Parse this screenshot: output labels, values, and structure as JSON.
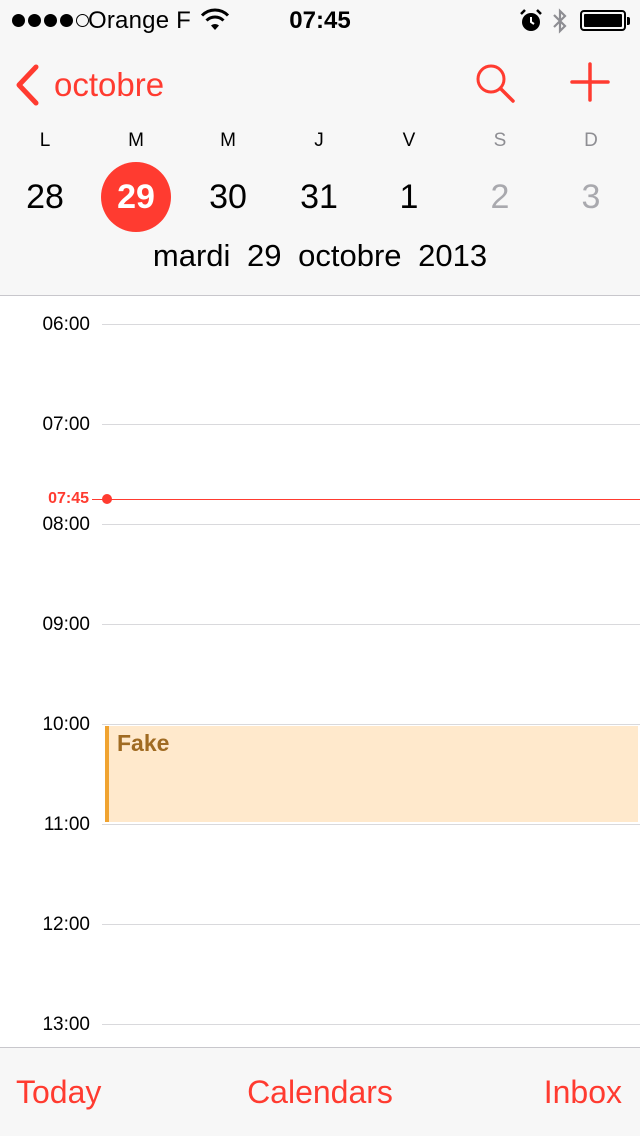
{
  "status_bar": {
    "carrier": "Orange F",
    "time": "07:45",
    "signal_bars": 4,
    "signal_max": 5,
    "battery_level": 1.0,
    "icons": [
      "signal-dots-icon",
      "wifi-icon",
      "alarm-icon",
      "bluetooth-icon",
      "battery-icon"
    ]
  },
  "header": {
    "back_label": "octobre",
    "search_icon": "search-icon",
    "add_icon": "plus-icon",
    "accent_color": "#ff3b30"
  },
  "week": {
    "days": [
      {
        "letter": "L",
        "number": "28",
        "selected": false,
        "weekend": false
      },
      {
        "letter": "M",
        "number": "29",
        "selected": true,
        "weekend": false
      },
      {
        "letter": "M",
        "number": "30",
        "selected": false,
        "weekend": false
      },
      {
        "letter": "J",
        "number": "31",
        "selected": false,
        "weekend": false
      },
      {
        "letter": "V",
        "number": "1",
        "selected": false,
        "weekend": false
      },
      {
        "letter": "S",
        "number": "2",
        "selected": false,
        "weekend": true
      },
      {
        "letter": "D",
        "number": "3",
        "selected": false,
        "weekend": true
      }
    ],
    "full_date": "mardi 29 octobre 2013"
  },
  "timeline": {
    "hours": [
      "06:00",
      "07:00",
      "08:00",
      "09:00",
      "10:00",
      "11:00",
      "12:00",
      "13:00"
    ],
    "now_label": "07:45",
    "now_color": "#ff3b30"
  },
  "events": [
    {
      "title": "Fake",
      "start": "10:00",
      "end": "11:00",
      "color": "#ffe9cc",
      "bar_color": "#f0a330"
    }
  ],
  "tabbar": {
    "today": "Today",
    "calendars": "Calendars",
    "inbox": "Inbox"
  }
}
